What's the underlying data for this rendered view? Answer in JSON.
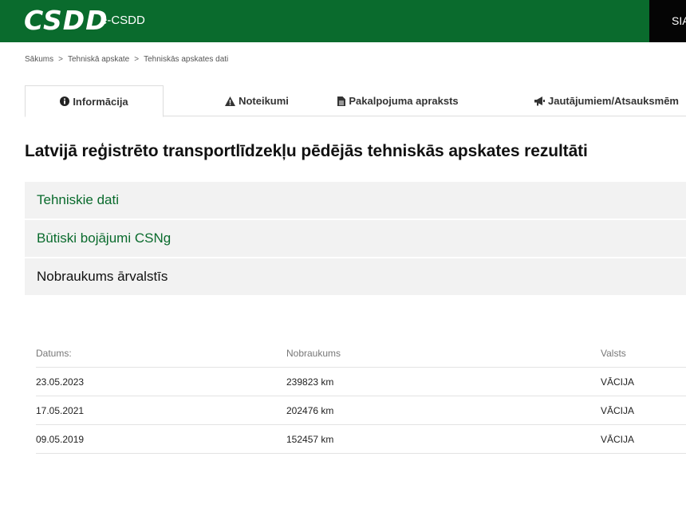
{
  "header": {
    "logo_text": "CSDD",
    "app_name": "e-CSDD",
    "lang_label": "SIA"
  },
  "breadcrumb": {
    "items": [
      "Sākums",
      "Tehniskā apskate",
      "Tehniskās apskates dati"
    ],
    "separator": ">"
  },
  "tabs": [
    {
      "label": "Informācija",
      "icon": "info-icon",
      "active": true
    },
    {
      "label": "Noteikumi",
      "icon": "warning-icon",
      "active": false
    },
    {
      "label": "Pakalpojuma apraksts",
      "icon": "document-icon",
      "active": false
    },
    {
      "label": "Jautājumiem/Atsauksmēm",
      "icon": "megaphone-icon",
      "active": false
    }
  ],
  "page_title": "Latvijā reģistrēto transportlīdzekļu pēdējās tehniskās apskates rezultāti",
  "panels": [
    {
      "label": "Tehniskie dati"
    },
    {
      "label": "Būtiski bojājumi CSNg"
    },
    {
      "label": "Nobraukums ārvalstīs"
    }
  ],
  "mileage_table": {
    "headers": [
      "Datums:",
      "Nobraukums",
      "Valsts"
    ],
    "rows": [
      {
        "date": "23.05.2023",
        "mileage": "239823 km",
        "country": "VĀCIJA"
      },
      {
        "date": "17.05.2021",
        "mileage": "202476 km",
        "country": "VĀCIJA"
      },
      {
        "date": "09.05.2019",
        "mileage": "152457 km",
        "country": "VĀCIJA"
      }
    ]
  },
  "colors": {
    "brand_green": "#0a6b2d",
    "panel_bg": "#f2f2f2"
  }
}
